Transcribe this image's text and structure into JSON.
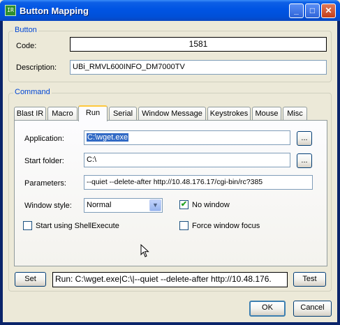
{
  "window": {
    "title": "Button Mapping"
  },
  "button_group": {
    "label": "Button",
    "code_label": "Code:",
    "code_value": "1581",
    "description_label": "Description:",
    "description_value": "UBi_RMVL600INFO_DM7000TV"
  },
  "command_group": {
    "label": "Command",
    "tabs": [
      "Blast IR",
      "Macro",
      "Run",
      "Serial",
      "Window Message",
      "Keystrokes",
      "Mouse",
      "Misc"
    ],
    "active_tab": "Run"
  },
  "run_tab": {
    "application_label": "Application:",
    "application_value": "C:\\wget.exe",
    "browse_label": "...",
    "start_folder_label": "Start folder:",
    "start_folder_value": "C:\\",
    "parameters_label": "Parameters:",
    "parameters_value": "--quiet --delete-after http://10.48.176.17/cgi-bin/rc?385",
    "window_style_label": "Window style:",
    "window_style_value": "Normal",
    "no_window_label": "No window",
    "no_window_checked": true,
    "shell_execute_label": "Start using ShellExecute",
    "shell_execute_checked": false,
    "force_focus_label": "Force window focus",
    "force_focus_checked": false
  },
  "command_bar": {
    "set_label": "Set",
    "command_text": "Run: C:\\wget.exe|C:\\|--quiet --delete-after http://10.48.176.",
    "test_label": "Test"
  },
  "footer": {
    "ok_label": "OK",
    "cancel_label": "Cancel"
  }
}
